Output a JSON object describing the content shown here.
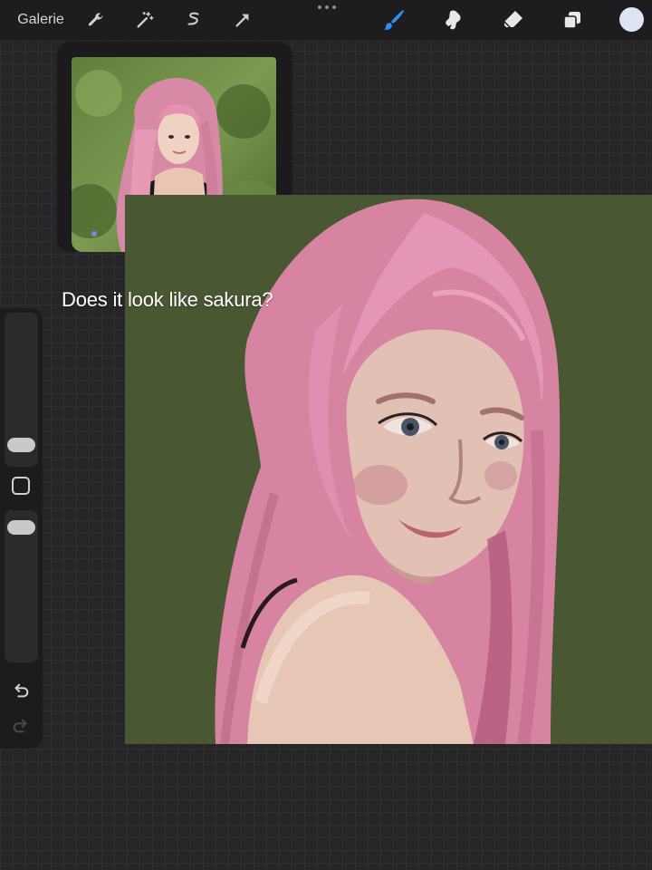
{
  "toolbar": {
    "gallery_label": "Galerie",
    "left_tools": [
      "wrench-icon",
      "magic-wand-icon",
      "selection-icon",
      "transform-arrow-icon"
    ],
    "right_tools": [
      "brush-icon",
      "smudge-icon",
      "eraser-icon",
      "layers-icon"
    ],
    "active_tool": "brush-icon",
    "current_color": "#dfe3f6"
  },
  "reference_window": {
    "visible": true
  },
  "canvas": {
    "background_color": "#495733"
  },
  "caption": {
    "text": "Does it look like sakura?"
  },
  "sidebar": {
    "brush_size": 0.5,
    "opacity": 0.5,
    "tools": [
      "modify-button",
      "undo-icon",
      "redo-icon"
    ]
  }
}
